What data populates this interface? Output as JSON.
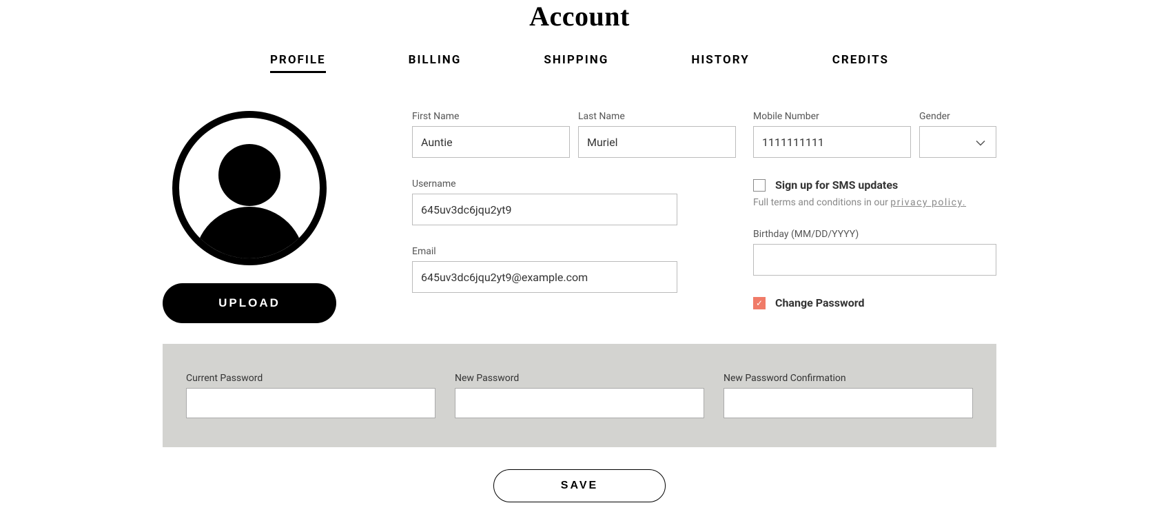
{
  "page_title": "Account",
  "tabs": [
    {
      "label": "PROFILE",
      "active": true
    },
    {
      "label": "BILLING",
      "active": false
    },
    {
      "label": "SHIPPING",
      "active": false
    },
    {
      "label": "HISTORY",
      "active": false
    },
    {
      "label": "CREDITS",
      "active": false
    }
  ],
  "upload_button": "UPLOAD",
  "fields": {
    "first_name": {
      "label": "First Name",
      "value": "Auntie"
    },
    "last_name": {
      "label": "Last Name",
      "value": "Muriel"
    },
    "username": {
      "label": "Username",
      "value": "645uv3dc6jqu2yt9"
    },
    "email": {
      "label": "Email",
      "value": "645uv3dc6jqu2yt9@example.com"
    },
    "mobile": {
      "label": "Mobile Number",
      "value": "1111111111"
    },
    "gender": {
      "label": "Gender",
      "value": ""
    },
    "birthday": {
      "label": "Birthday (MM/DD/YYYY)",
      "value": ""
    }
  },
  "sms_checkbox": {
    "label": "Sign up for SMS updates",
    "checked": false
  },
  "terms_text_prefix": "Full terms and conditions in our ",
  "terms_link": "privacy policy.",
  "change_password": {
    "label": "Change Password",
    "checked": true
  },
  "password_fields": {
    "current": {
      "label": "Current Password",
      "value": ""
    },
    "new": {
      "label": "New Password",
      "value": ""
    },
    "confirm": {
      "label": "New Password Confirmation",
      "value": ""
    }
  },
  "save_button": "SAVE"
}
